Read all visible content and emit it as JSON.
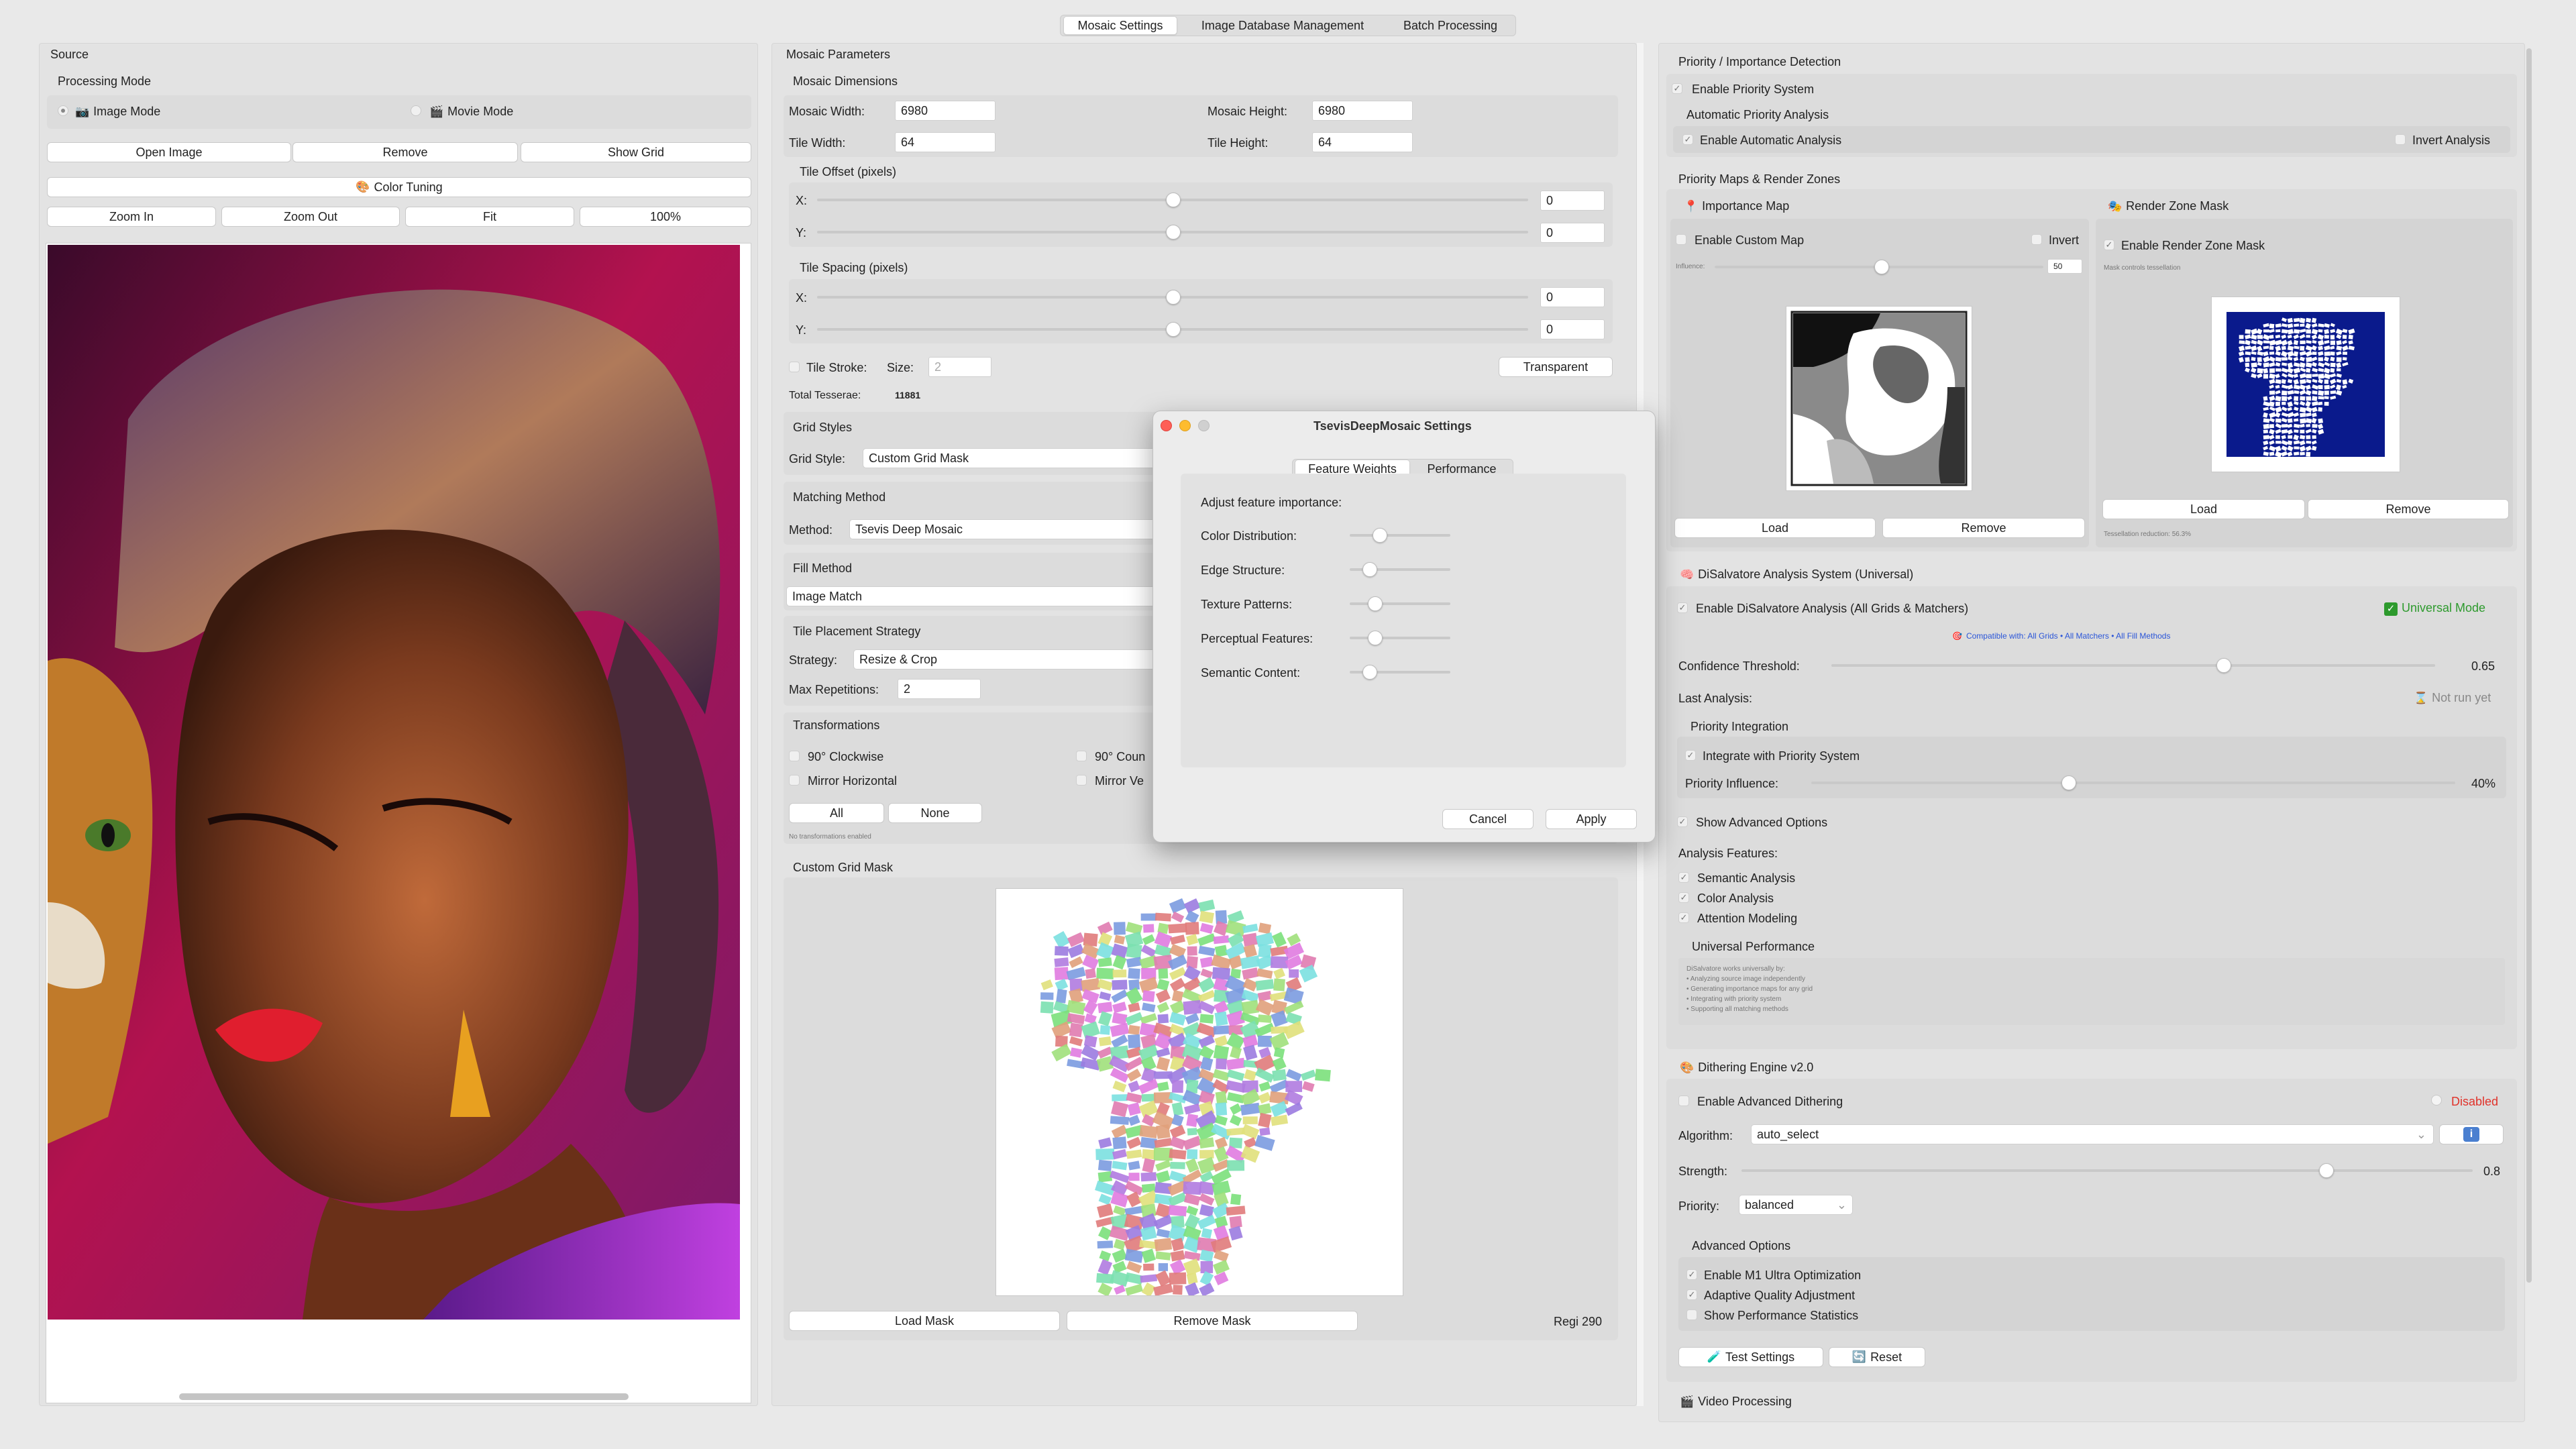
{
  "top_tabs": [
    "Mosaic Settings",
    "Image Database Management",
    "Batch Processing"
  ],
  "source": {
    "title": "Source",
    "processing_mode": "Processing Mode",
    "image_mode": "Image Mode",
    "movie_mode": "Movie Mode",
    "open_image": "Open Image",
    "remove": "Remove",
    "show_grid": "Show Grid",
    "color_tuning": "Color Tuning",
    "zoom_in": "Zoom In",
    "zoom_out": "Zoom Out",
    "fit": "Fit",
    "zoom_pct": "100%"
  },
  "params": {
    "title": "Mosaic Parameters",
    "dimensions": "Mosaic Dimensions",
    "mosaic_width_label": "Mosaic Width:",
    "mosaic_width": "6980",
    "mosaic_height_label": "Mosaic Height:",
    "mosaic_height": "6980",
    "tile_width_label": "Tile Width:",
    "tile_width": "64",
    "tile_height_label": "Tile Height:",
    "tile_height": "64",
    "tile_offset": "Tile Offset (pixels)",
    "tile_spacing": "Tile Spacing (pixels)",
    "x_label": "X:",
    "y_label": "Y:",
    "offset_x": "0",
    "offset_y": "0",
    "spacing_x": "0",
    "spacing_y": "0",
    "tile_stroke": "Tile Stroke:",
    "size_label": "Size:",
    "size_value": "2",
    "transparent": "Transparent",
    "total_tesserae_label": "Total Tesserae:",
    "total_tesserae": "11881",
    "grid_styles": "Grid Styles",
    "grid_style_label": "Grid Style:",
    "grid_style": "Custom Grid Mask",
    "matching_method": "Matching Method",
    "method_label": "Method:",
    "method": "Tsevis Deep Mosaic",
    "fill_method": "Fill Method",
    "fill": "Image Match",
    "placement": "Tile Placement Strategy",
    "strategy_label": "Strategy:",
    "strategy": "Resize & Crop",
    "max_rep_label": "Max Repetitions:",
    "max_rep": "2",
    "transformations": "Transformations",
    "rot_cw": "90° Clockwise",
    "rot_ccw": "90° Coun",
    "mirror_h": "Mirror Horizontal",
    "mirror_v": "Mirror Ve",
    "all": "All",
    "none": "None",
    "no_trans": "No transformations enabled",
    "custom_mask": "Custom Grid Mask",
    "load_mask": "Load Mask",
    "remove_mask": "Remove Mask",
    "regions": "Regi 290"
  },
  "dialog": {
    "title": "TsevisDeepMosaic Settings",
    "tabs": [
      "Feature Weights",
      "Performance"
    ],
    "adjust": "Adjust feature importance:",
    "features": [
      {
        "label": "Color Distribution:",
        "value": 0.3
      },
      {
        "label": "Edge Structure:",
        "value": 0.2
      },
      {
        "label": "Texture Patterns:",
        "value": 0.25
      },
      {
        "label": "Perceptual Features:",
        "value": 0.25
      },
      {
        "label": "Semantic Content:",
        "value": 0.2
      }
    ],
    "cancel": "Cancel",
    "apply": "Apply"
  },
  "priority": {
    "title": "Priority / Importance Detection",
    "enable_priority": "Enable Priority System",
    "auto_analysis": "Automatic Priority Analysis",
    "enable_auto": "Enable Automatic Analysis",
    "invert_analysis": "Invert Analysis",
    "maps_title": "Priority Maps & Render Zones",
    "importance_map": "Importance Map",
    "enable_custom_map": "Enable Custom Map",
    "invert": "Invert",
    "influence": "Influence:",
    "influence_value": "50",
    "load": "Load",
    "remove": "Remove",
    "render_zone_mask": "Render Zone Mask",
    "enable_render_zone": "Enable Render Zone Mask",
    "mask_controls": "Mask controls tessellation",
    "tess_reduction": "Tessellation reduction: 56.3%"
  },
  "disalvatore": {
    "title": "DiSalvatore Analysis System (Universal)",
    "enable": "Enable DiSalvatore Analysis (All Grids & Matchers)",
    "universal_mode": "Universal Mode",
    "compatible": "Compatible with: All Grids • All Matchers • All Fill Methods",
    "confidence_label": "Confidence Threshold:",
    "confidence": "0.65",
    "confidence_frac": 0.65,
    "last_analysis": "Last Analysis:",
    "not_run": "Not run yet",
    "priority_integration": "Priority Integration",
    "integrate": "Integrate with Priority System",
    "priority_influence_label": "Priority Influence:",
    "priority_influence": "40%",
    "priority_influence_frac": 0.4,
    "show_advanced": "Show Advanced Options",
    "analysis_features": "Analysis Features:",
    "semantic": "Semantic Analysis",
    "color": "Color Analysis",
    "attention": "Attention Modeling",
    "universal_perf": "Universal Performance",
    "perf_lines": [
      "DiSalvatore works universally by:",
      "• Analyzing source image independently",
      "• Generating importance maps for any grid",
      "• Integrating with priority system",
      "• Supporting all matching methods"
    ]
  },
  "dithering": {
    "title": "Dithering Engine v2.0",
    "enable": "Enable Advanced Dithering",
    "status": "Disabled",
    "algorithm_label": "Algorithm:",
    "algorithm": "auto_select",
    "strength_label": "Strength:",
    "strength": "0.8",
    "strength_frac": 0.8,
    "priority_label": "Priority:",
    "priority": "balanced",
    "advanced": "Advanced Options",
    "m1": "Enable M1 Ultra Optimization",
    "adaptive": "Adaptive Quality Adjustment",
    "perf_stats": "Show Performance Statistics",
    "test": "Test Settings",
    "reset": "Reset",
    "video": "Video Processing"
  },
  "colors": {
    "accent_blue": "#2a55d8",
    "disabled_red": "#e0322a",
    "universal_green": "#2d9a2d",
    "mask_blue": "#0a1a8c"
  }
}
